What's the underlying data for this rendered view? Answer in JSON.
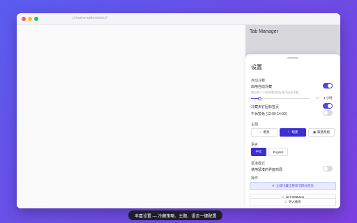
{
  "browser": {
    "url": "chrome-extension://"
  },
  "sidebar": {
    "title": "Tab Manager"
  },
  "settings": {
    "title": "设置",
    "auto_freeze": {
      "section": "自动冷藏",
      "enable_label": "启用自动冷藏",
      "enable_on": true,
      "hint": "超过多少小时未使用的标签页自动冷藏",
      "slider_min": "1",
      "slider_max": "24",
      "slider_value_label": "4 小时",
      "slider_value_fraction": 0.14,
      "freeze_unpinned_label": "冷藏未钉固标签页",
      "freeze_unpinned_on": true,
      "quiet_hours_label": "午休暂免 (12:00-14:00)",
      "quiet_hours_on": false
    },
    "theme": {
      "section": "主题",
      "options": [
        {
          "icon": "sun-icon",
          "glyph": "☀",
          "label": "明亮"
        },
        {
          "icon": "moon-icon",
          "glyph": "☾",
          "label": "暗黑"
        },
        {
          "icon": "monitor-icon",
          "glyph": "▣",
          "label": "跟随系统"
        }
      ],
      "selected_index": 1
    },
    "language": {
      "section": "语言",
      "options": [
        "中文",
        "English"
      ],
      "selected_index": 0
    },
    "compact": {
      "section": "紧凑模式",
      "label": "使用紧凑的界面布局",
      "on": false
    },
    "actions": {
      "section": "操作",
      "buttons": [
        {
          "icon": "snowflake-icon",
          "glyph": "❄",
          "label": "立即冷藏全部非活跃标签页"
        },
        {
          "icon": "box-icon",
          "glyph": "▤",
          "label": "导出完整备份"
        },
        {
          "icon": "upload-icon",
          "glyph": "⇪",
          "label": "导入备份"
        }
      ]
    }
  },
  "caption": "丰富设置 — 冷藏策略、主题、语言一键配置",
  "colors": {
    "accent": "#5146e5",
    "active_button": "#3b2fd1",
    "background_start": "#5b5cf0",
    "background_end": "#7a3fe0"
  }
}
